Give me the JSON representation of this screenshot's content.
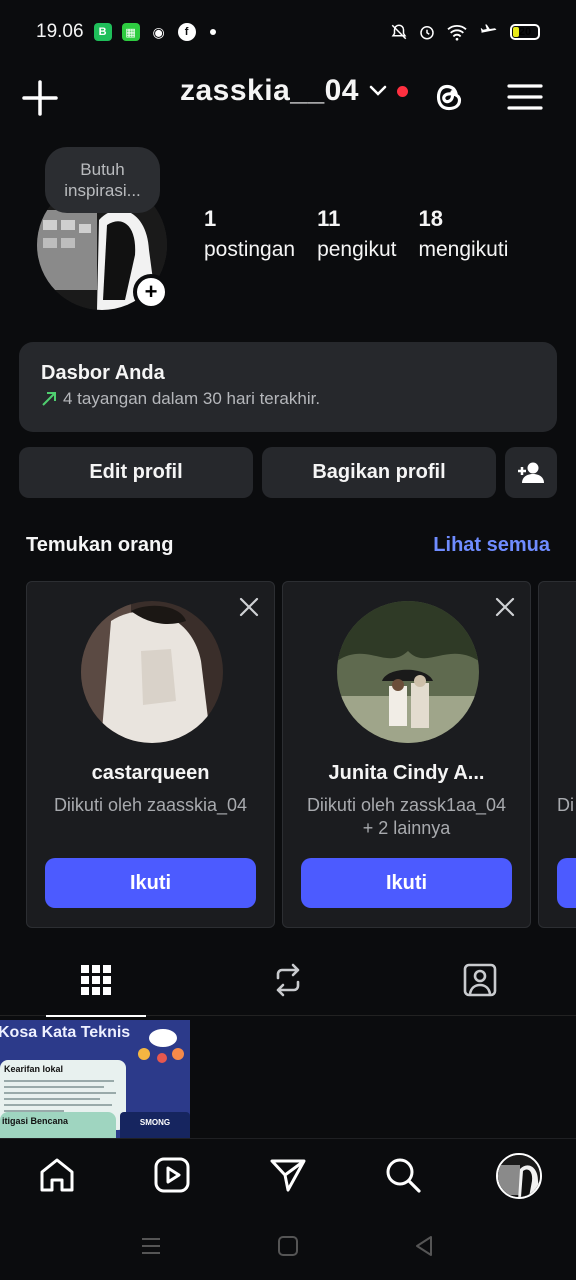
{
  "status_bar": {
    "time": "19.06",
    "battery": "20",
    "left_icons": [
      "wa-business-icon",
      "messages-icon",
      "app-icon",
      "facebook-icon"
    ],
    "right_icons": [
      "mute-icon",
      "alarm-icon",
      "wifi-icon",
      "airplane-icon"
    ]
  },
  "header": {
    "username": "zasskia__04",
    "icons": [
      "plus-icon",
      "chevron-down-icon",
      "threads-icon",
      "hamburger-menu-icon"
    ]
  },
  "profile": {
    "note": "Butuh inspirasi...",
    "stats": [
      {
        "num": "1",
        "label": "postingan"
      },
      {
        "num": "11",
        "label": "pengikut"
      },
      {
        "num": "18",
        "label": "mengikuti"
      }
    ]
  },
  "dashboard": {
    "title": "Dasbor Anda",
    "subtitle": "4 tayangan dalam 30 hari terakhir.",
    "trend_icon": "trend-up-icon"
  },
  "actions": {
    "edit_label": "Edit profil",
    "share_label": "Bagikan profil"
  },
  "discover": {
    "title": "Temukan orang",
    "see_all": "Lihat semua",
    "cards": [
      {
        "name": "castarqueen",
        "followed": "Diikuti oleh zaasskia_04",
        "follow_label": "Ikuti"
      },
      {
        "name": "Junita Cindy A...",
        "followed": "Diikuti oleh zassk1aa_04 + 2 lainnya",
        "follow_label": "Ikuti"
      },
      {
        "followed": "Di"
      }
    ]
  },
  "post": {
    "title": "Kosa Kata Teknis",
    "card1_heading": "Kearifan lokal",
    "card2_heading": "itigasi Bencana",
    "badge": "SMONG"
  },
  "colors": {
    "background": "#0b0c0e",
    "surface": "#26282c",
    "accent_blue": "#4c5bff",
    "link_blue": "#6f8cff",
    "red_dot": "#ff3040",
    "trend_green": "#4fce6f"
  }
}
